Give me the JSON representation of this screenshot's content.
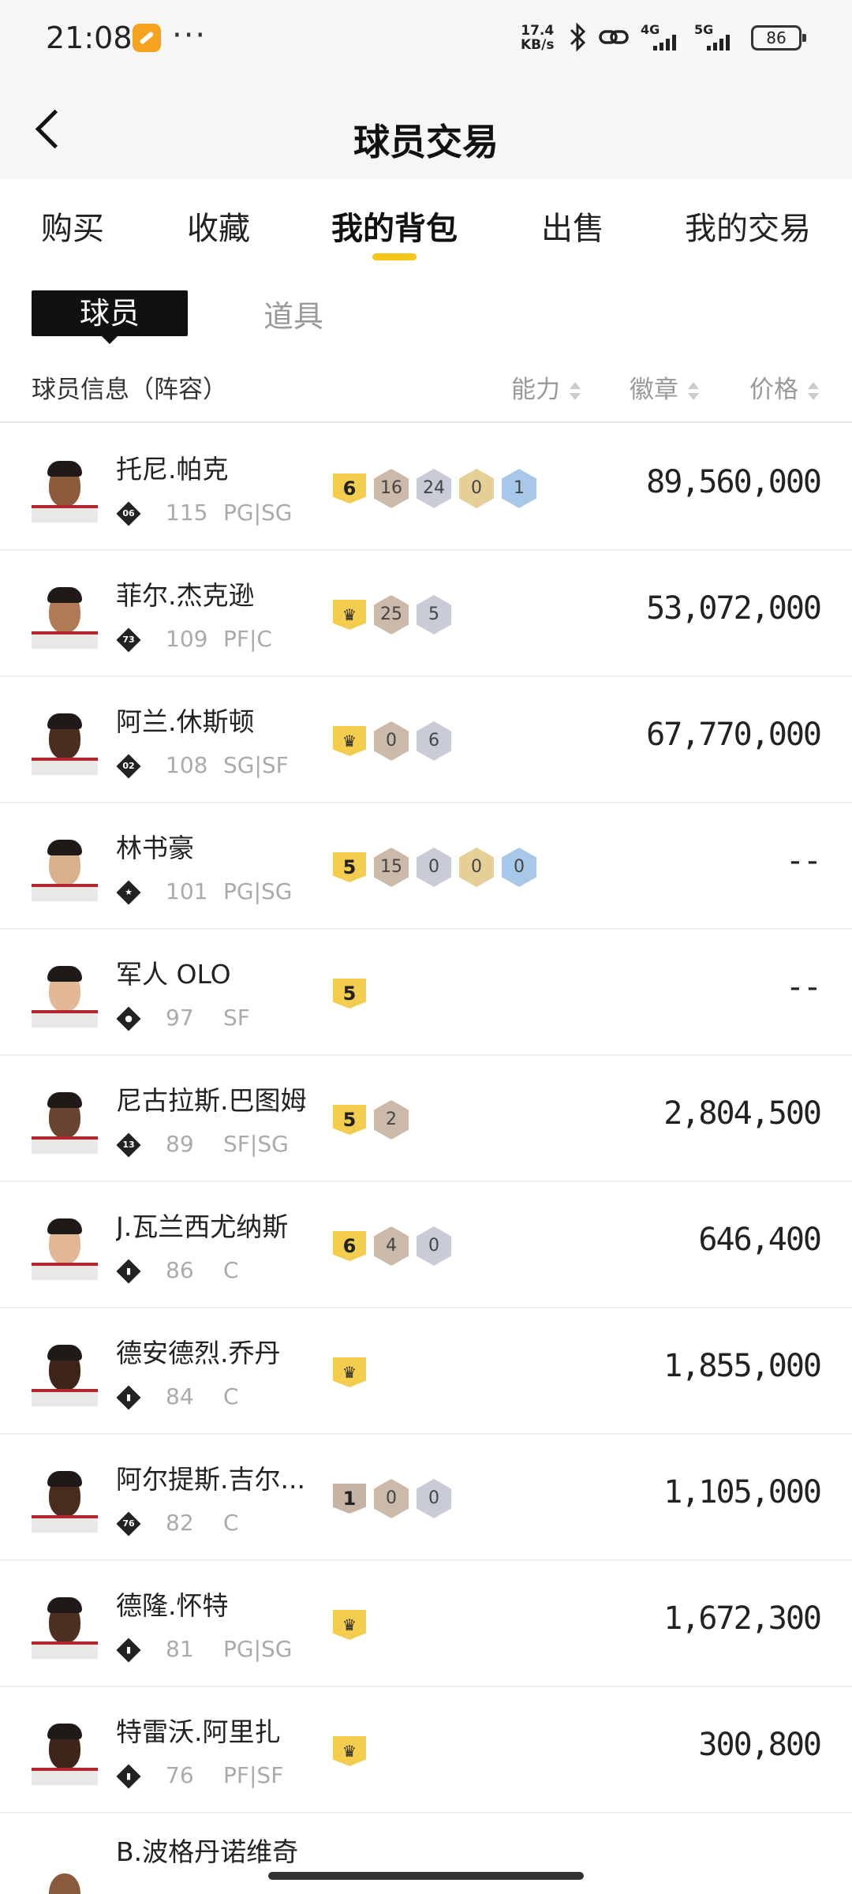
{
  "status_bar": {
    "time": "21:08",
    "app_badge_icon": "orange-app-icon",
    "more": "···",
    "net_speed": "17.4",
    "net_unit": "KB/s",
    "bluetooth_icon": "bluetooth-icon",
    "link_icon": "link-icon",
    "sim1": "4G",
    "sim2": "5G",
    "battery": "86"
  },
  "header": {
    "back_icon": "back-arrow-icon",
    "title": "球员交易"
  },
  "tabs": [
    {
      "label": "购买"
    },
    {
      "label": "收藏"
    },
    {
      "label": "我的背包"
    },
    {
      "label": "出售"
    },
    {
      "label": "我的交易"
    }
  ],
  "subtabs": {
    "active": "球员",
    "inactive": "道具"
  },
  "columns": {
    "info": "球员信息（阵容）",
    "ability": "能力",
    "badge": "徽章",
    "price": "价格"
  },
  "colors": {
    "accent": "#f5c518",
    "tier_gold": "#f2cd4e",
    "hex_bronze": "#cbb9a9",
    "hex_silver": "#c9ccd6",
    "hex_gold": "#e6cf96",
    "hex_hof": "#a7c8e8"
  },
  "players": [
    {
      "name": "托尼.帕克",
      "lineup": "06",
      "rating": "115",
      "position": "PG|SG",
      "tier": "6",
      "badges": [
        "16",
        "24",
        "0",
        "1"
      ],
      "price": "89,560,000"
    },
    {
      "name": "菲尔.杰克逊",
      "lineup": "73",
      "rating": "109",
      "position": "PF|C",
      "tier": "♛",
      "badges": [
        "25",
        "5"
      ],
      "price": "53,072,000"
    },
    {
      "name": "阿兰.休斯顿",
      "lineup": "02",
      "rating": "108",
      "position": "SG|SF",
      "tier": "♛",
      "badges": [
        "0",
        "6"
      ],
      "price": "67,770,000"
    },
    {
      "name": "林书豪",
      "lineup": "★",
      "rating": "101",
      "position": "PG|SG",
      "tier": "5",
      "badges": [
        "15",
        "0",
        "0",
        "0"
      ],
      "price": "--"
    },
    {
      "name": "军人 OLO",
      "lineup": "●",
      "rating": "97",
      "position": "SF",
      "tier": "5",
      "badges": [],
      "price": "--"
    },
    {
      "name": "尼古拉斯.巴图姆",
      "lineup": "13",
      "rating": "89",
      "position": "SF|SG",
      "tier": "5",
      "badges": [
        "2"
      ],
      "price": "2,804,500"
    },
    {
      "name": "J.瓦兰西尤纳斯",
      "lineup": "▮",
      "rating": "86",
      "position": "C",
      "tier": "6",
      "badges": [
        "4",
        "0"
      ],
      "price": "646,400"
    },
    {
      "name": "德安德烈.乔丹",
      "lineup": "▮",
      "rating": "84",
      "position": "C",
      "tier": "♛",
      "badges": [],
      "price": "1,855,000"
    },
    {
      "name": "阿尔提斯.吉尔...",
      "lineup": "76",
      "rating": "82",
      "position": "C",
      "tier": "1",
      "badges": [
        "0",
        "0"
      ],
      "price": "1,105,000"
    },
    {
      "name": "德隆.怀特",
      "lineup": "▮",
      "rating": "81",
      "position": "PG|SG",
      "tier": "♛",
      "badges": [],
      "price": "1,672,300"
    },
    {
      "name": "特雷沃.阿里扎",
      "lineup": "▮",
      "rating": "76",
      "position": "PF|SF",
      "tier": "♛",
      "badges": [],
      "price": "300,800"
    }
  ],
  "partial_row": {
    "name": "B.波格丹诺维奇"
  }
}
